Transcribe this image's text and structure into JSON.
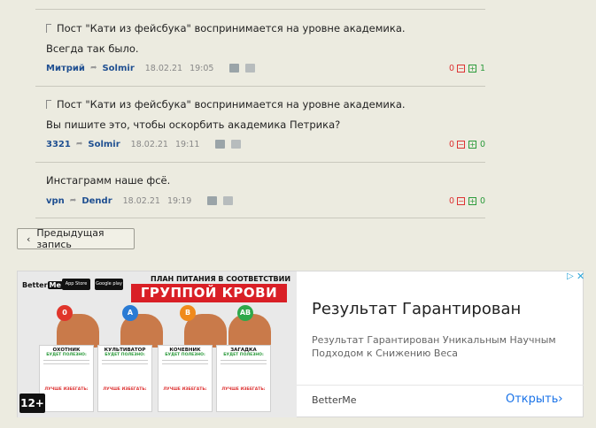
{
  "comments": [
    {
      "quote": "Пост \"Кати из фейсбука\" воспринимается на уровне академика.",
      "text": "Всегда так было.",
      "author": "Митрий",
      "reply_to": "Solmir",
      "date": "18.02.21",
      "time": "19:05",
      "minus_count": "0",
      "plus_count": "1"
    },
    {
      "quote": "Пост \"Кати из фейсбука\" воспринимается на уровне академика.",
      "text": "Вы пишите это, чтобы оскорбить академика Петрика?",
      "author": "3321",
      "reply_to": "Solmir",
      "date": "18.02.21",
      "time": "19:11",
      "minus_count": "0",
      "plus_count": "0"
    },
    {
      "quote": "",
      "text": "Инстаграмм наше фсё.",
      "author": "vpn",
      "reply_to": "Dendr",
      "date": "18.02.21",
      "time": "19:19",
      "minus_count": "0",
      "plus_count": "0"
    }
  ],
  "nav": {
    "prev_label": "Предыдущая запись",
    "chevron": "‹"
  },
  "ad": {
    "logo_text": "Better",
    "logo_badge": "Me",
    "store1": "App Store",
    "store2": "Google play",
    "headline_small": "ПЛАН ПИТАНИЯ В СООТВЕТСТВИИ С",
    "headline_big": "ГРУППОЙ КРОВИ",
    "columns": [
      {
        "badge": "0",
        "title": "ОХОТНИК",
        "good": "БУДЕТ ПОЛЕЗНО:",
        "bad": "ЛУЧШЕ ИЗБЕГАТЬ:",
        "color": "#e0352b"
      },
      {
        "badge": "A",
        "title": "КУЛЬТИВАТОР",
        "good": "БУДЕТ ПОЛЕЗНО:",
        "bad": "ЛУЧШЕ ИЗБЕГАТЬ:",
        "color": "#2a7bd4"
      },
      {
        "badge": "B",
        "title": "КОЧЕВНИК",
        "good": "БУДЕТ ПОЛЕЗНО:",
        "bad": "ЛУЧШЕ ИЗБЕГАТЬ:",
        "color": "#f08a1c"
      },
      {
        "badge": "AB",
        "title": "ЗАГАДКА",
        "good": "БУДЕТ ПОЛЕЗНО:",
        "bad": "ЛУЧШЕ ИЗБЕГАТЬ:",
        "color": "#2ea84a"
      }
    ],
    "age_rating": "12+",
    "title": "Результат Гарантирован",
    "description": "Результат Гарантирован Уникальным Научным Подходом к Снижению Веса",
    "brand": "BetterMe",
    "cta": "Открыть",
    "cta_icon": "chevron-right-icon"
  },
  "colors": {
    "link": "#1f4f91",
    "negative": "#dd3333",
    "positive": "#2a9a3a",
    "cta": "#1a73e8"
  }
}
